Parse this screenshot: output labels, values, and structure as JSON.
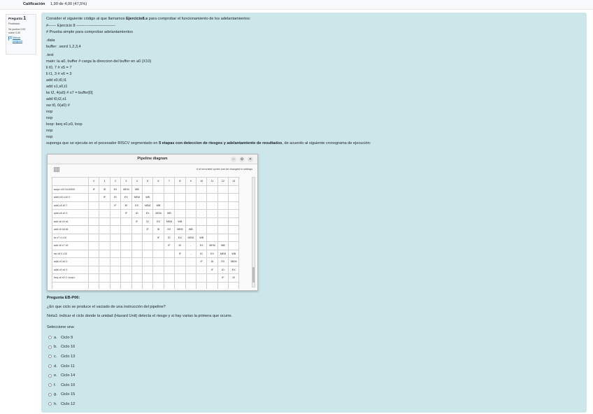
{
  "grade": {
    "label": "Calificación",
    "value": "1,90 de 4,00 (47,5%)"
  },
  "question_info": {
    "label": "Pregunta",
    "number": "1",
    "state": "Finalizado",
    "grade_line1": "Se puntúa 0,50",
    "grade_line2": "sobre 0,50",
    "flag_line1": "Marcar",
    "flag_line2": "pregunta"
  },
  "intro": {
    "pre": "Consider el siguiente código al que llamamos ",
    "bold": "Ejercicio8.s",
    "post": " para comprobar el funcionamiento de los adelantamientos:"
  },
  "code": [
    "#------ Ejercicio 8 ------------------------------",
    "# Prueba simple para comprobar adelantamientos",
    "",
    ".data",
    "buffer: .word 1,2,3,4",
    "",
    ".text",
    "main: la a0, buffer # carga la direccion del buffer en a0 (X10)",
    "li t0, 7 # x5 = 7",
    "li t1, 3 # x6 = 3",
    "add s0,t0,t1",
    "add s1,s0,t1",
    "lw t2, 4(a0) # x7 = buffer[0]",
    "add t0,t2,s1",
    "sw t0, 0(a0) #",
    "nop",
    "nop",
    "loop: beq x0,x0, loop",
    "nop",
    "nop"
  ],
  "statement": {
    "pre": "suponga que se ejecuta en el pocesador RISCV segmentado en ",
    "bold": "5 etapas con deteccion de riesgos y adelantamiento de resultados",
    "post": ", de acuerdo al siguiente cronograma de ejecución:"
  },
  "pipeline_window": {
    "title": "Pipeline diagram",
    "note": "# of recorded cycles can be changed in settings",
    "min_glyph": "–",
    "settings_glyph": "⚙",
    "close_glyph": "✕",
    "cycles": [
      "0",
      "1",
      "2",
      "3",
      "4",
      "5",
      "6",
      "7",
      "8",
      "9",
      "10",
      "11",
      "12",
      "13"
    ],
    "rows": [
      {
        "instr": "auipc x10 0x10000",
        "stages": [
          "IF",
          "ID",
          "EX",
          "MEM",
          "WB",
          "",
          "",
          "",
          "",
          "",
          "",
          "",
          "",
          ""
        ]
      },
      {
        "instr": "addi x10 x10 0",
        "stages": [
          "",
          "IF",
          "ID",
          "EX",
          "MEM",
          "WB",
          "",
          "",
          "",
          "",
          "",
          "",
          "",
          ""
        ]
      },
      {
        "instr": "addi x5 x0 7",
        "stages": [
          "",
          "",
          "IF",
          "ID",
          "EX",
          "MEM",
          "WB",
          "",
          "",
          "",
          "",
          "",
          "",
          ""
        ]
      },
      {
        "instr": "addi x6 x0 3",
        "stages": [
          "",
          "",
          "",
          "IF",
          "ID",
          "EX",
          "MEM",
          "WB",
          "",
          "",
          "",
          "",
          "",
          ""
        ]
      },
      {
        "instr": "add x8 x5 x6",
        "stages": [
          "",
          "",
          "",
          "",
          "IF",
          "ID",
          "EX",
          "MEM",
          "WB",
          "",
          "",
          "",
          "",
          ""
        ]
      },
      {
        "instr": "add x9 x8 x6",
        "stages": [
          "",
          "",
          "",
          "",
          "",
          "IF",
          "ID",
          "EX",
          "MEM",
          "WB",
          "",
          "",
          "",
          ""
        ]
      },
      {
        "instr": "lw x7 4 x10",
        "stages": [
          "",
          "",
          "",
          "",
          "",
          "",
          "IF",
          "ID",
          "EX",
          "MEM",
          "WB",
          "",
          "",
          ""
        ]
      },
      {
        "instr": "add x5 x7 x9",
        "stages": [
          "",
          "",
          "",
          "",
          "",
          "",
          "",
          "IF",
          "ID",
          "-",
          "EX",
          "MEM",
          "WB",
          ""
        ]
      },
      {
        "instr": "sw x5 0 x10",
        "stages": [
          "",
          "",
          "",
          "",
          "",
          "",
          "",
          "",
          "IF",
          "-",
          "ID",
          "EX",
          "MEM",
          "WB"
        ]
      },
      {
        "instr": "addi x0 x0 0",
        "stages": [
          "",
          "",
          "",
          "",
          "",
          "",
          "",
          "",
          "",
          "",
          "IF",
          "ID",
          "EX",
          "MEM"
        ]
      },
      {
        "instr": "addi x0 x0 0",
        "stages": [
          "",
          "",
          "",
          "",
          "",
          "",
          "",
          "",
          "",
          "",
          "",
          "IF",
          "ID",
          "EX"
        ]
      },
      {
        "instr": "beq x0 x0 0 <loop>",
        "stages": [
          "",
          "",
          "",
          "",
          "",
          "",
          "",
          "",
          "",
          "",
          "",
          "",
          "IF",
          "ID"
        ]
      },
      {
        "instr": "",
        "stages": [
          "",
          "",
          "",
          "",
          "",
          "",
          "",
          "",
          "",
          "",
          "",
          "",
          "",
          ""
        ]
      }
    ]
  },
  "question": {
    "title": "Pregunta EB-P06:",
    "text": "¿En que ciclo se produce el vaciado de una instrucción del pipeline?",
    "note": "Nota1: indicar el ciclo donde la unidad (Hazard Unit) detecta el riesgo y si hay varias la primera que ocurre.",
    "select_label": "Seleccione una:",
    "options": [
      {
        "letter": "a.",
        "text": "Ciclo 9"
      },
      {
        "letter": "b.",
        "text": "Ciclo 16"
      },
      {
        "letter": "c.",
        "text": "Ciclo 13"
      },
      {
        "letter": "d.",
        "text": "Ciclo 11"
      },
      {
        "letter": "e.",
        "text": "Ciclo 14"
      },
      {
        "letter": "f.",
        "text": "Ciclo 10"
      },
      {
        "letter": "g.",
        "text": "Ciclo 15"
      },
      {
        "letter": "h.",
        "text": "Ciclo 12"
      }
    ]
  },
  "icons": {
    "flag": "flag-icon",
    "table_view": "table-icon",
    "scroll_up": "chevron-up-icon",
    "scroll_down": "chevron-down-icon"
  }
}
